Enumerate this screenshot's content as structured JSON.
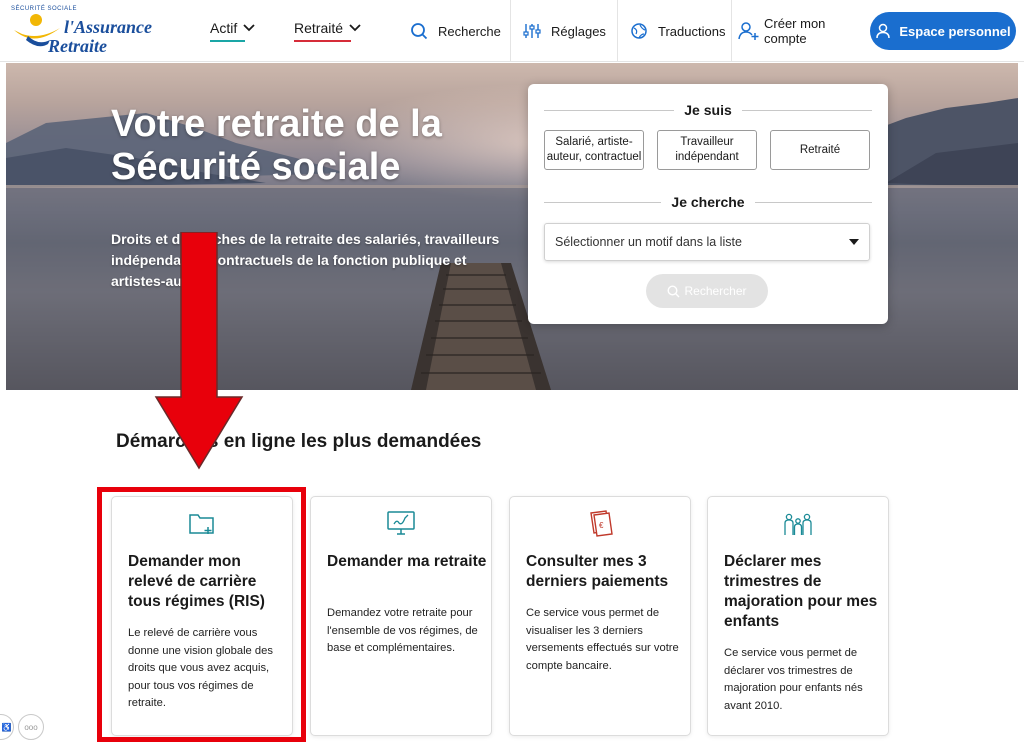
{
  "header": {
    "logo": {
      "line1": "l'Assurance",
      "line2": "Retraite",
      "arc": "SÉCURITÉ SOCIALE"
    },
    "nav": [
      {
        "label": "Actif",
        "accent": "#1aa6a6"
      },
      {
        "label": "Retraité",
        "accent": "#d62c39"
      }
    ],
    "search_label": "Recherche",
    "settings_label": "Réglages",
    "translations_label": "Traductions",
    "create_account_label": "Créer mon compte",
    "personal_space_label": "Espace personnel",
    "icons": {
      "search": "search-icon",
      "settings": "sliders-icon",
      "translations": "globe-icon",
      "create_account": "user-plus-icon",
      "personal_space": "user-icon"
    }
  },
  "hero": {
    "title": "Votre retraite de la Sécurité sociale",
    "description": "Droits et démarches de la retraite des salariés, travailleurs indépendants, contractuels de la fonction publique et artistes-auteurs"
  },
  "search_box": {
    "i_am_heading": "Je suis",
    "profiles": [
      {
        "label": "Salarié, artiste-auteur, contractuel"
      },
      {
        "label": "Travailleur indépendant"
      },
      {
        "label": "Retraité"
      }
    ],
    "i_search_heading": "Je cherche",
    "motif_placeholder": "Sélectionner un motif dans la liste",
    "search_button": "Rechercher"
  },
  "section": {
    "title": "Démarches en ligne les plus demandées",
    "cards": [
      {
        "icon": "folder-plus-icon",
        "title": "Demander mon relevé de carrière tous régimes (RIS)",
        "description": "Le relevé de carrière vous donne une vision globale des droits que vous avez acquis, pour tous vos régimes de retraite."
      },
      {
        "icon": "computer-signature-icon",
        "title": "Demander ma retraite",
        "description": "Demandez votre retraite pour l'ensemble de vos régimes, de base et complémentaires."
      },
      {
        "icon": "euro-document-icon",
        "title": "Consulter mes 3 derniers paiements",
        "description": "Ce service vous permet de visualiser les 3 derniers versements effectués sur votre compte bancaire."
      },
      {
        "icon": "family-icon",
        "title": "Déclarer mes trimestres de majoration pour mes enfants",
        "description": "Ce service vous permet de déclarer vos trimestres de majoration pour enfants nés avant 2010."
      }
    ]
  },
  "colors": {
    "primary_blue": "#1a6ecf",
    "logo_blue": "#1a4e9c",
    "annotation_red": "#e8000b",
    "teal": "#1aa6a6"
  }
}
